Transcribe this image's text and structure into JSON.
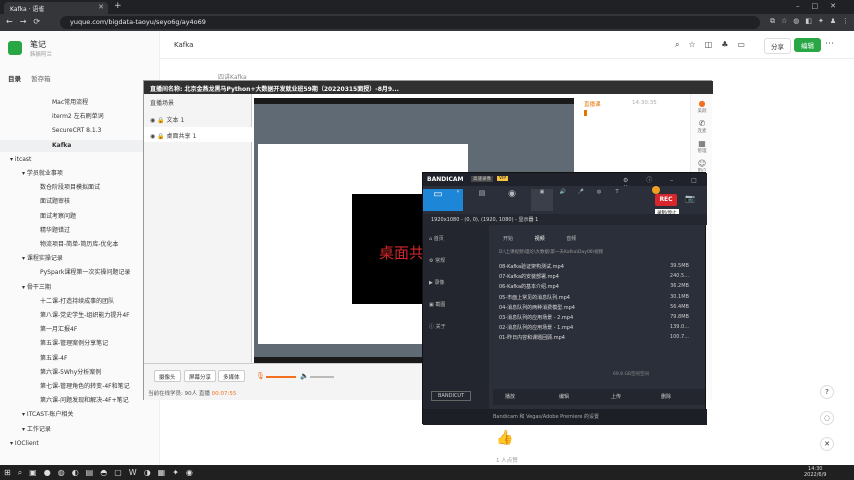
{
  "browser": {
    "tab_title": "Kafka · 语雀",
    "url": "yuque.com/bigdata-taoyu/seyo6g/ay4o69"
  },
  "sidebar": {
    "space_name": "笔记",
    "space_sub": "韩振阿兰",
    "tabs": [
      "目录",
      "暂存箱"
    ],
    "items": [
      {
        "label": "Mac常用流程",
        "level": 3
      },
      {
        "label": "iterm2 左右刷单词",
        "level": 3
      },
      {
        "label": "SecureCRT 8.1.3",
        "level": 3
      },
      {
        "label": "Kafka",
        "level": 3,
        "active": true
      },
      {
        "label": "itcast",
        "level": 0
      },
      {
        "label": "学员就业事项",
        "level": 1
      },
      {
        "label": "数仓阶段项目模拟面试",
        "level": 2
      },
      {
        "label": "面试题审核",
        "level": 2
      },
      {
        "label": "面试考察问题",
        "level": 2
      },
      {
        "label": "精华题错过",
        "level": 2
      },
      {
        "label": "物流项目-简单-简历库-优化本",
        "level": 2
      },
      {
        "label": "课程实操记录",
        "level": 1
      },
      {
        "label": "PySpark课程第一次实操问题记录",
        "level": 2
      },
      {
        "label": "骨干三期",
        "level": 1
      },
      {
        "label": "十二课-打造持续成事的团队",
        "level": 2
      },
      {
        "label": "第八课-党史学生-组织能力提升4F",
        "level": 2
      },
      {
        "label": "第一月汇报4F",
        "level": 2
      },
      {
        "label": "第五课-管理案例分享笔记",
        "level": 2
      },
      {
        "label": "第五课-4F",
        "level": 2
      },
      {
        "label": "第六课-5Why分析案例",
        "level": 2
      },
      {
        "label": "第七课-管理角色的转变-4F和笔记",
        "level": 2
      },
      {
        "label": "第六课-问题发现和解决-4F+笔记",
        "level": 2
      },
      {
        "label": "ITCAST-账户相关",
        "level": 1
      },
      {
        "label": "工作记录",
        "level": 1
      },
      {
        "label": "IOClient",
        "level": 0
      }
    ]
  },
  "doc": {
    "title": "Kafka",
    "share": "分享",
    "edit": "编辑",
    "bg_line": "四讲Kafka",
    "likes": "1 人点赞"
  },
  "live": {
    "title": "直播间名称: 北京金燕龙黑马Python+大数据开发就业班59期（20220315面授）-8月9...",
    "scene_header": "直播场景",
    "scenes": [
      "文本 1",
      "桌面共享 1"
    ],
    "preview_text": "桌面共",
    "chat_user": "直播课",
    "chat_time": "14:30:35",
    "tools": [
      "美颜",
      "连麦",
      "管理",
      "用户",
      "消息",
      "打赏",
      "白板"
    ],
    "bottom_buttons": [
      "摄像头",
      "屏幕分享",
      "多媒体"
    ],
    "online": "当前在线学员: 90人",
    "timer_label": "直播",
    "timer": "00:07:55"
  },
  "bandicam": {
    "logo": "BANDICAM",
    "badge": "高速录像",
    "vip": "VIP",
    "rec": "REC",
    "rec_tip": "录制/停止",
    "modes": [
      "",
      "",
      "",
      "",
      "",
      "",
      ""
    ],
    "info": "1920x1080 - (0, 0), (1920, 1080) - 显示器 1",
    "nav": [
      "首页",
      "常规",
      "录像",
      "截图",
      "关于"
    ],
    "tabs": [
      "开始",
      "视频",
      "音频"
    ],
    "path": "D:\\上课视频\\理论\\大数据\\第一天Kafka\\Day06\\视频",
    "files": [
      {
        "name": "08-Kafka验证架构测试.mp4",
        "size": "39.5MB"
      },
      {
        "name": "07-Kafka的安装部署.mp4",
        "size": "240.5..."
      },
      {
        "name": "06-Kafka的基本介绍.mp4",
        "size": "36.2MB"
      },
      {
        "name": "05-市面上常见的消息队列.mp4",
        "size": "30.1MB"
      },
      {
        "name": "04-消息队列的两种消费模型.mp4",
        "size": "56.4MB"
      },
      {
        "name": "03-消息队列的应用场景 - 2.mp4",
        "size": "79.8MB"
      },
      {
        "name": "02-消息队列的应用场景 - 1.mp4",
        "size": "139.0..."
      },
      {
        "name": "01-昨日内容和课题回顾.mp4",
        "size": "100.7..."
      }
    ],
    "free": "69.8 GB空闲空间",
    "actions": [
      "播放",
      "编辑",
      "上传",
      "删除"
    ],
    "bandicut": "BANDICUT",
    "status": "Bandicam 和 Vegas/Adobe Premiere 的设置"
  },
  "taskbar": {
    "time": "14:30",
    "date": "2022/6/9"
  }
}
